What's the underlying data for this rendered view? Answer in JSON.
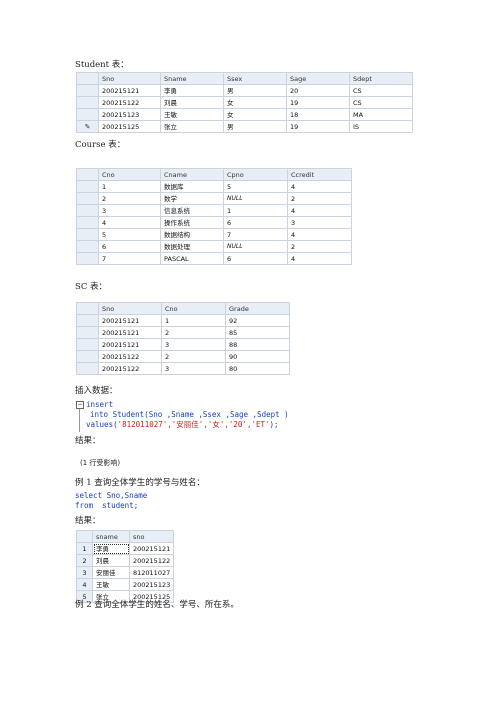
{
  "student_caption": "Student 表：",
  "student_table": {
    "headers": [
      "Sno",
      "Sname",
      "Ssex",
      "Sage",
      "Sdept"
    ],
    "rows": [
      [
        "200215121",
        "李勇",
        "男",
        "20",
        "CS"
      ],
      [
        "200215122",
        "刘晨",
        "女",
        "19",
        "CS"
      ],
      [
        "200215123",
        "王敏",
        "女",
        "18",
        "MA"
      ],
      [
        "200215125",
        "张立",
        "男",
        "19",
        "IS"
      ]
    ]
  },
  "course_caption": "Course 表：",
  "course_table": {
    "headers": [
      "Cno",
      "Cname",
      "Cpno",
      "Ccredit"
    ],
    "rows": [
      [
        "1",
        "数据库",
        "5",
        "4"
      ],
      [
        "2",
        "数学",
        "NULL",
        "2"
      ],
      [
        "3",
        "信息系统",
        "1",
        "4"
      ],
      [
        "4",
        "操作系统",
        "6",
        "3"
      ],
      [
        "5",
        "数据结构",
        "7",
        "4"
      ],
      [
        "6",
        "数据处理",
        "NULL",
        "2"
      ],
      [
        "7",
        "PASCAL",
        "6",
        "4"
      ]
    ]
  },
  "sc_caption": "SC 表：",
  "sc_table": {
    "headers": [
      "Sno",
      "Cno",
      "Grade"
    ],
    "rows": [
      [
        "200215121",
        "1",
        "92"
      ],
      [
        "200215121",
        "2",
        "85"
      ],
      [
        "200215121",
        "3",
        "88"
      ],
      [
        "200215122",
        "2",
        "90"
      ],
      [
        "200215122",
        "3",
        "80"
      ]
    ]
  },
  "insert_caption": "插入数据：",
  "insert_code": {
    "line1": "insert",
    "line2": "into Student(Sno ,Sname ,Ssex ,Sage ,Sdept )",
    "line3_prefix": "values(",
    "line3_values": "'812011027','安丽佳','女','20','ET'",
    "line3_suffix": ");"
  },
  "result_caption_1": "结果：",
  "rows_affected": "(1 行受影响)",
  "example1_caption": "例 1   查询全体学生的学号与姓名：",
  "example1_code": {
    "line1": "select Sno,Sname",
    "line2": "from  student;"
  },
  "result_caption_2": "结果：",
  "result_table": {
    "headers": [
      "sname",
      "sno"
    ],
    "rows": [
      [
        "1",
        "李勇",
        "200215121"
      ],
      [
        "2",
        "刘晨",
        "200215122"
      ],
      [
        "3",
        "安丽佳",
        "812011027"
      ],
      [
        "4",
        "王敏",
        "200215123"
      ],
      [
        "5",
        "张立",
        "200215125"
      ]
    ]
  },
  "example2_caption": "例 2  查询全体学生的姓名、学号、所在系。",
  "icons": {
    "edit_row": "pencil-icon",
    "collapse": "minus-box-icon"
  }
}
